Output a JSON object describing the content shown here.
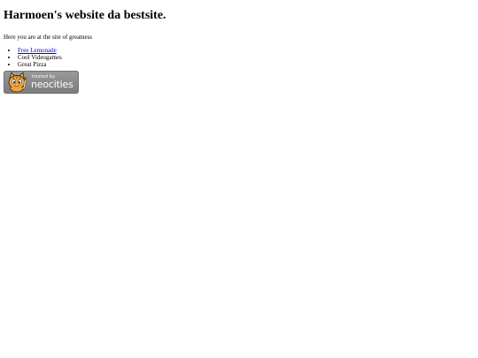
{
  "header": {
    "title": "Harmoen's website da bestsite."
  },
  "main": {
    "intro": "Here you are at the site of greatness",
    "items": [
      {
        "label": "Free Lemonade",
        "link": true
      },
      {
        "label": "Cool Videogames",
        "link": false
      },
      {
        "label": "Great Pizza",
        "link": false
      }
    ]
  },
  "footer": {
    "badge": {
      "hosted_text": "hosted by",
      "brand_text": "neocities",
      "icon": "neocities-cat-icon",
      "background": "#8a8a8a",
      "cat_color": "#f2a33a"
    }
  },
  "colors": {
    "link": "#0000ee",
    "text": "#000000",
    "background": "#ffffff"
  }
}
